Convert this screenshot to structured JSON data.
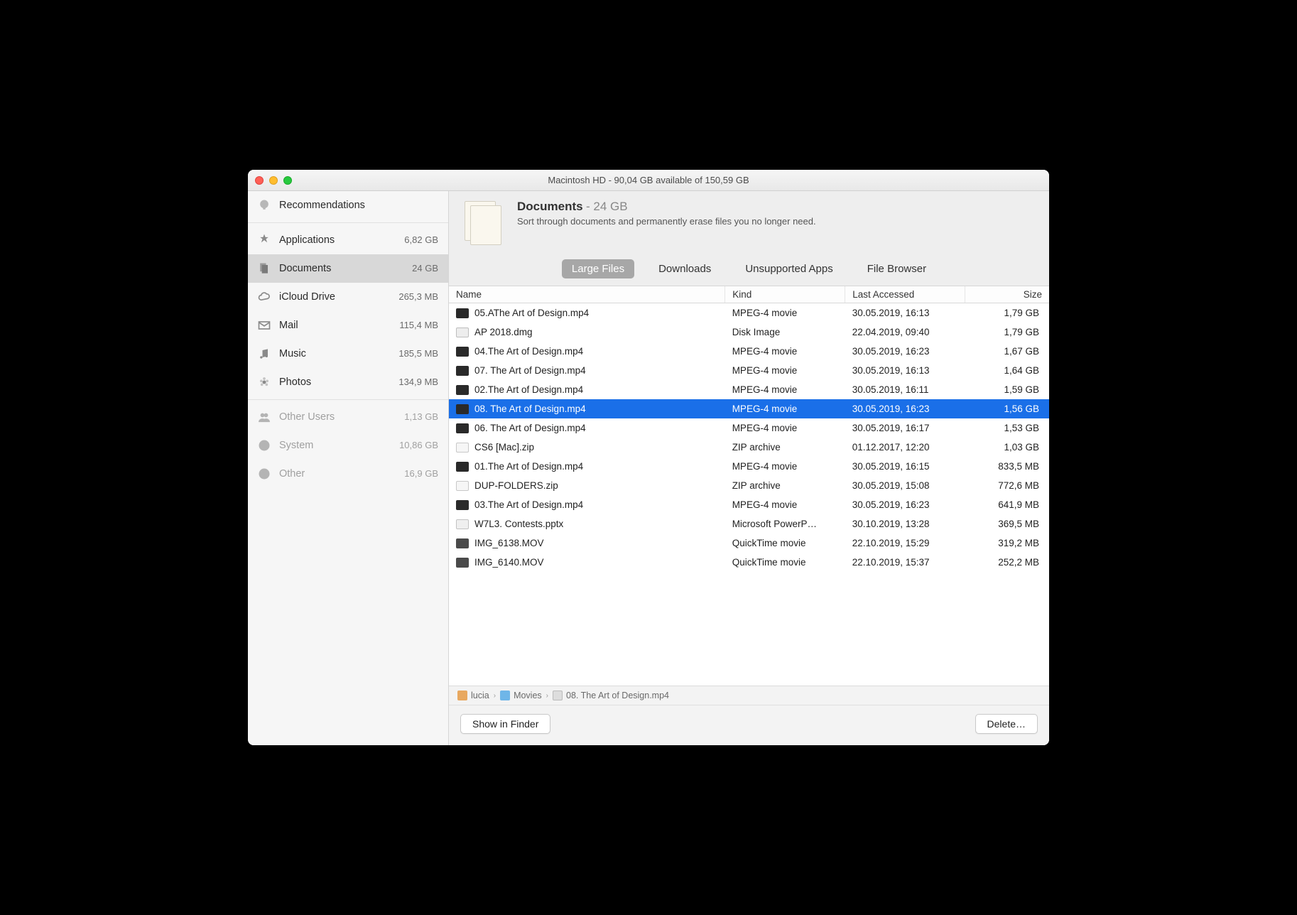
{
  "window_title": "Macintosh HD - 90,04 GB available of 150,59 GB",
  "sidebar": {
    "items": [
      {
        "icon": "lightbulb-icon",
        "label": "Recommendations",
        "value": "",
        "dim": false
      },
      {
        "icon": "apps-icon",
        "label": "Applications",
        "value": "6,82 GB",
        "dim": false
      },
      {
        "icon": "documents-icon",
        "label": "Documents",
        "value": "24 GB",
        "selected": true,
        "dim": false
      },
      {
        "icon": "cloud-icon",
        "label": "iCloud Drive",
        "value": "265,3 MB",
        "dim": false
      },
      {
        "icon": "mail-icon",
        "label": "Mail",
        "value": "115,4 MB",
        "dim": false
      },
      {
        "icon": "music-icon",
        "label": "Music",
        "value": "185,5 MB",
        "dim": false
      },
      {
        "icon": "photos-icon",
        "label": "Photos",
        "value": "134,9 MB",
        "dim": false
      },
      {
        "icon": "users-icon",
        "label": "Other Users",
        "value": "1,13 GB",
        "dim": true
      },
      {
        "icon": "system-icon",
        "label": "System",
        "value": "10,86 GB",
        "dim": true
      },
      {
        "icon": "other-icon",
        "label": "Other",
        "value": "16,9 GB",
        "dim": true
      }
    ]
  },
  "header": {
    "title": "Documents",
    "size": "24 GB",
    "description": "Sort through documents and permanently erase files you no longer need."
  },
  "tabs": [
    {
      "label": "Large Files",
      "active": true
    },
    {
      "label": "Downloads",
      "active": false
    },
    {
      "label": "Unsupported Apps",
      "active": false
    },
    {
      "label": "File Browser",
      "active": false
    }
  ],
  "columns": {
    "name": "Name",
    "kind": "Kind",
    "last": "Last Accessed",
    "size": "Size"
  },
  "files": [
    {
      "icon": "video",
      "name": "05.AThe Art of Design.mp4",
      "kind": "MPEG-4 movie",
      "last": "30.05.2019, 16:13",
      "size": "1,79 GB"
    },
    {
      "icon": "disk",
      "name": "AP 2018.dmg",
      "kind": "Disk Image",
      "last": "22.04.2019, 09:40",
      "size": "1,79 GB"
    },
    {
      "icon": "video",
      "name": "04.The Art of Design.mp4",
      "kind": "MPEG-4 movie",
      "last": "30.05.2019, 16:23",
      "size": "1,67 GB"
    },
    {
      "icon": "video",
      "name": "07. The Art of Design.mp4",
      "kind": "MPEG-4 movie",
      "last": "30.05.2019, 16:13",
      "size": "1,64 GB"
    },
    {
      "icon": "video",
      "name": "02.The Art of Design.mp4",
      "kind": "MPEG-4 movie",
      "last": "30.05.2019, 16:11",
      "size": "1,59 GB"
    },
    {
      "icon": "video",
      "name": "08. The Art of Design.mp4",
      "kind": "MPEG-4 movie",
      "last": "30.05.2019, 16:23",
      "size": "1,56 GB",
      "selected": true
    },
    {
      "icon": "video",
      "name": "06. The Art of Design.mp4",
      "kind": "MPEG-4 movie",
      "last": "30.05.2019, 16:17",
      "size": "1,53 GB"
    },
    {
      "icon": "zip",
      "name": "CS6 [Mac].zip",
      "kind": "ZIP archive",
      "last": "01.12.2017, 12:20",
      "size": "1,03 GB"
    },
    {
      "icon": "video",
      "name": "01.The Art of Design.mp4",
      "kind": "MPEG-4 movie",
      "last": "30.05.2019, 16:15",
      "size": "833,5 MB"
    },
    {
      "icon": "zip",
      "name": "DUP-FOLDERS.zip",
      "kind": "ZIP archive",
      "last": "30.05.2019, 15:08",
      "size": "772,6 MB"
    },
    {
      "icon": "video",
      "name": "03.The Art of Design.mp4",
      "kind": "MPEG-4 movie",
      "last": "30.05.2019, 16:23",
      "size": "641,9 MB"
    },
    {
      "icon": "pptx",
      "name": "W7L3. Contests.pptx",
      "kind": "Microsoft PowerP…",
      "last": "30.10.2019, 13:28",
      "size": "369,5 MB"
    },
    {
      "icon": "mov",
      "name": "IMG_6138.MOV",
      "kind": "QuickTime movie",
      "last": "22.10.2019, 15:29",
      "size": "319,2 MB"
    },
    {
      "icon": "mov",
      "name": "IMG_6140.MOV",
      "kind": "QuickTime movie",
      "last": "22.10.2019, 15:37",
      "size": "252,2 MB"
    }
  ],
  "path": {
    "segments": [
      {
        "icon": "home",
        "label": "lucia"
      },
      {
        "icon": "folder",
        "label": "Movies"
      },
      {
        "icon": "file",
        "label": "08. The Art of Design.mp4"
      }
    ],
    "separator": "›"
  },
  "buttons": {
    "show_in_finder": "Show in Finder",
    "delete": "Delete…"
  }
}
